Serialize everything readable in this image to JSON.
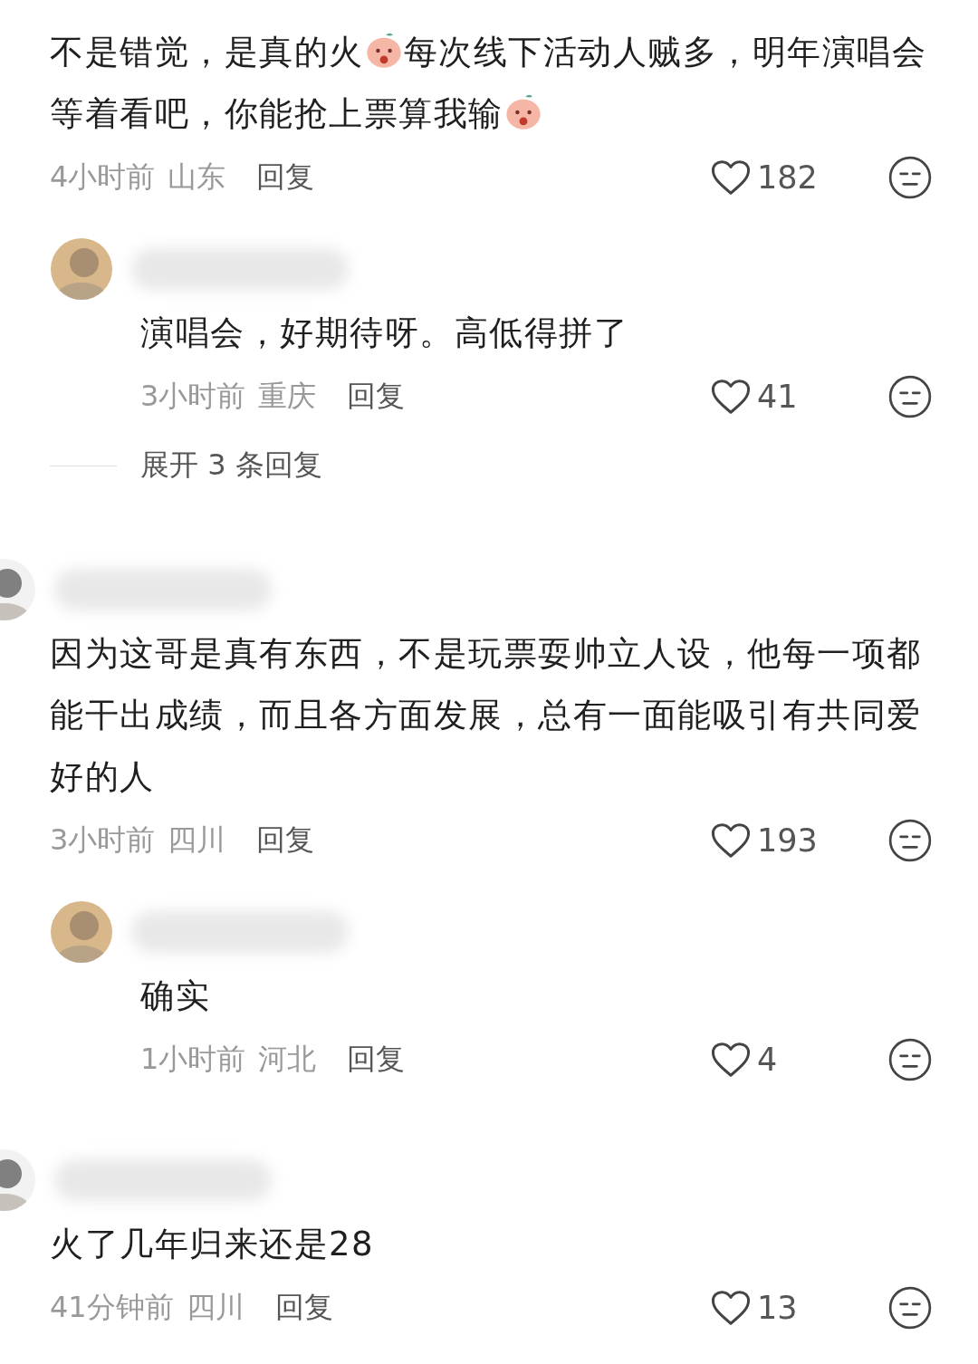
{
  "comments": [
    {
      "kind": "comment",
      "segments": [
        {
          "kind": "text",
          "text": "不是错觉，是真的火"
        },
        {
          "kind": "emoji"
        },
        {
          "kind": "text",
          "text": "每次线下活动人贼多，明年演唱会等着看吧，你能抢上票算我输"
        },
        {
          "kind": "emoji"
        }
      ],
      "time": "4小时前",
      "location": "山东",
      "reply": "回复",
      "likes": "182"
    },
    {
      "kind": "reply",
      "segments": [
        {
          "kind": "text",
          "text": "演唱会，好期待呀。高低得拼了"
        }
      ],
      "time": "3小时前",
      "location": "重庆",
      "reply": "回复",
      "likes": "41",
      "expand": "展开 3 条回复"
    },
    {
      "kind": "comment",
      "segments": [
        {
          "kind": "text",
          "text": "因为这哥是真有东西，不是玩票耍帅立人设，他每一项都能干出成绩，而且各方面发展，总有一面能吸引有共同爱好的人"
        }
      ],
      "time": "3小时前",
      "location": "四川",
      "reply": "回复",
      "likes": "193"
    },
    {
      "kind": "reply",
      "segments": [
        {
          "kind": "text",
          "text": "确实"
        }
      ],
      "time": "1小时前",
      "location": "河北",
      "reply": "回复",
      "likes": "4"
    },
    {
      "kind": "comment",
      "segments": [
        {
          "kind": "text",
          "text": "火了几年归来还是28"
        }
      ],
      "time": "41分钟前",
      "location": "四川",
      "reply": "回复",
      "likes": "13"
    }
  ]
}
